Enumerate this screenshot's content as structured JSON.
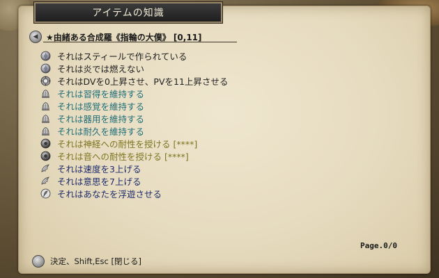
{
  "window": {
    "title": "アイテムの知識"
  },
  "item": {
    "name": "★由緒ある合成羅《指輪の大僕》 [0,11]",
    "enchantments": [
      {
        "text": "それはスティールで作られている",
        "color": "#1e1e1e",
        "icon": "gray-orb-icon"
      },
      {
        "text": "それは炎では燃えない",
        "color": "#1e1e1e",
        "icon": "gray-orb-icon"
      },
      {
        "text": "それはDVを0上昇させ、PVを11上昇させる",
        "color": "#1e1e1e",
        "icon": "shield-gear-icon"
      },
      {
        "text": "それは習得を維持する",
        "color": "#1f6e78",
        "icon": "bell-icon"
      },
      {
        "text": "それは感覚を維持する",
        "color": "#1f6e78",
        "icon": "bell-icon"
      },
      {
        "text": "それは器用を維持する",
        "color": "#1f6e78",
        "icon": "bell-icon"
      },
      {
        "text": "それは耐久を維持する",
        "color": "#1f6e78",
        "icon": "bell-icon"
      },
      {
        "text": "それは神経への耐性を授ける [****]",
        "color": "#7c7420",
        "icon": "dark-orb-icon"
      },
      {
        "text": "それは音への耐性を授ける [****]",
        "color": "#7c7420",
        "icon": "dark-orb-icon"
      },
      {
        "text": "それは速度を3上げる",
        "color": "#1c2a6c",
        "icon": "wing-icon"
      },
      {
        "text": "それは意思を7上げる",
        "color": "#1c2a6c",
        "icon": "wing-icon"
      },
      {
        "text": "それはあなたを浮遊させる",
        "color": "#1c2a6c",
        "icon": "feather-icon"
      }
    ]
  },
  "pagination": {
    "label": "Page.0/0"
  },
  "footer": {
    "hint": "決定、Shift,Esc [閉じる]"
  }
}
